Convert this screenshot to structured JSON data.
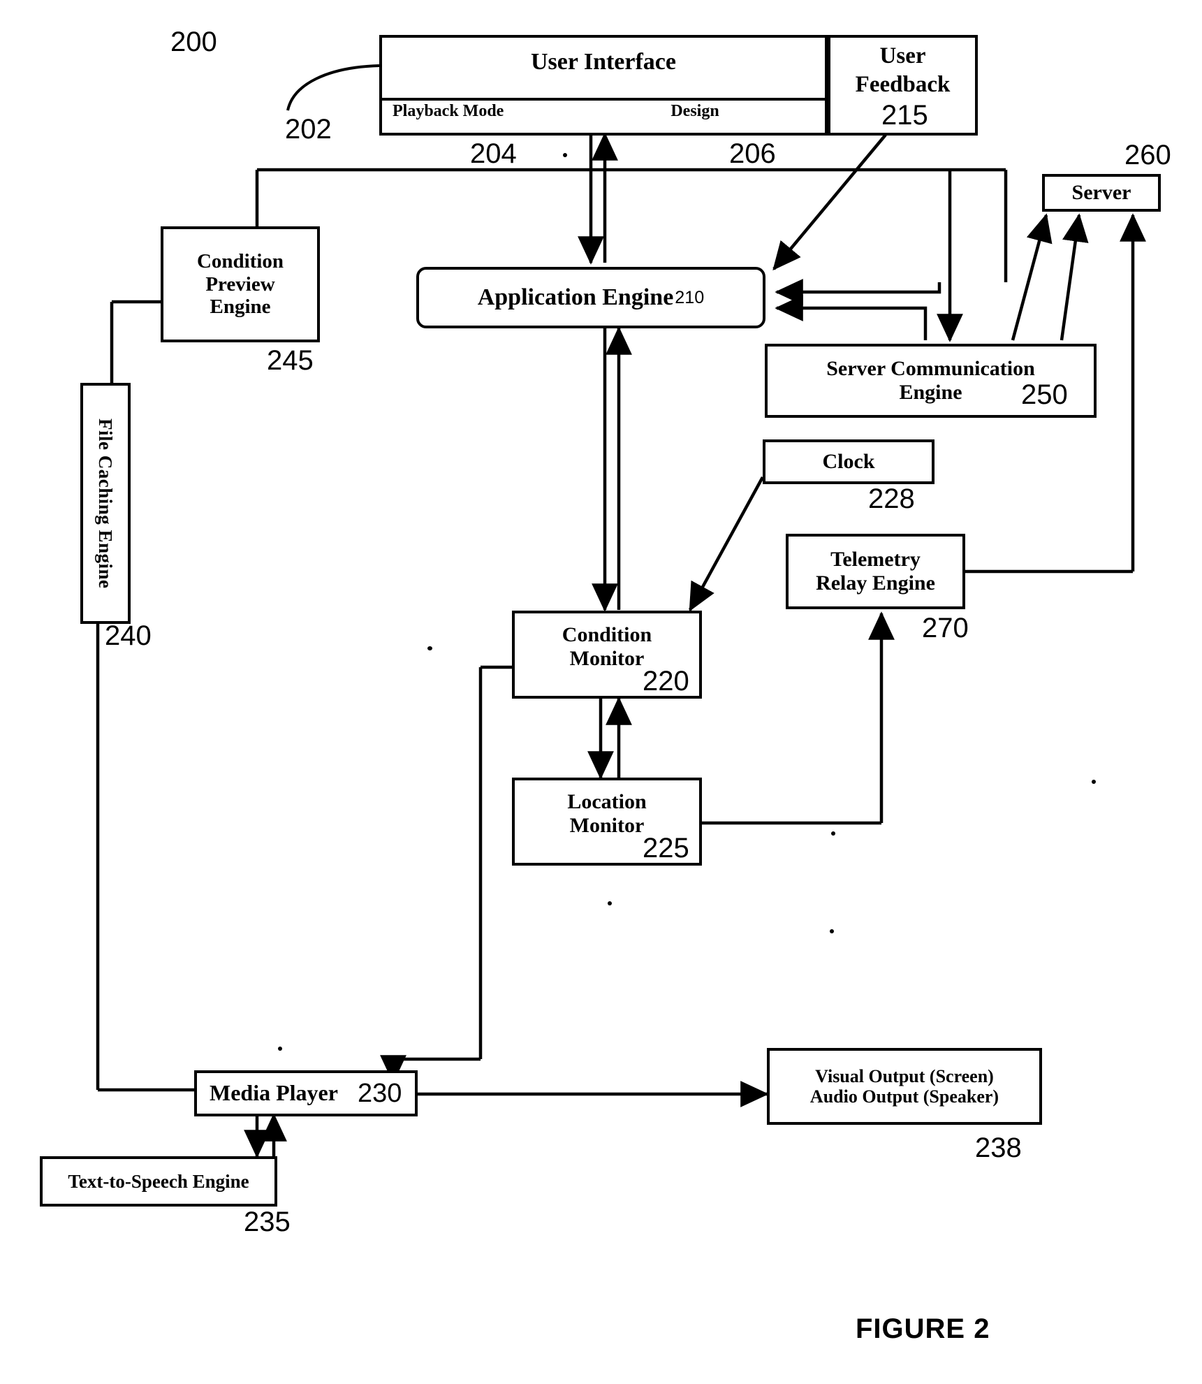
{
  "figure": {
    "label": "FIGURE 2",
    "diagram_ref": "200"
  },
  "nodes": {
    "user_interface": {
      "title": "User Interface",
      "ref": "202",
      "tabs": [
        {
          "label": "Playback Mode",
          "ref": "204"
        },
        {
          "label": "Design",
          "ref": "206"
        }
      ]
    },
    "user_feedback": {
      "label": "User\nFeedback",
      "line1": "User",
      "line2": "Feedback",
      "ref": "215"
    },
    "application_engine": {
      "label": "Application Engine",
      "ref": "210"
    },
    "condition_preview_engine": {
      "line1": "Condition",
      "line2": "Preview",
      "line3": "Engine",
      "ref": "245"
    },
    "file_caching_engine": {
      "label": "File Caching Engine",
      "ref": "240"
    },
    "server": {
      "label": "Server",
      "ref": "260"
    },
    "server_communication_engine": {
      "line1": "Server Communication",
      "line2": "Engine",
      "ref": "250"
    },
    "clock": {
      "label": "Clock",
      "ref": "228"
    },
    "telemetry_relay_engine": {
      "line1": "Telemetry",
      "line2": "Relay Engine",
      "ref": "270"
    },
    "condition_monitor": {
      "line1": "Condition",
      "line2": "Monitor",
      "ref": "220"
    },
    "location_monitor": {
      "line1": "Location",
      "line2": "Monitor",
      "ref": "225"
    },
    "media_player": {
      "label": "Media Player",
      "ref": "230"
    },
    "text_to_speech_engine": {
      "label": "Text-to-Speech Engine",
      "ref": "235"
    },
    "output": {
      "line1": "Visual Output (Screen)",
      "line2": "Audio Output (Speaker)",
      "ref": "238"
    }
  },
  "colors": {
    "line": "#000000",
    "background": "#ffffff"
  }
}
